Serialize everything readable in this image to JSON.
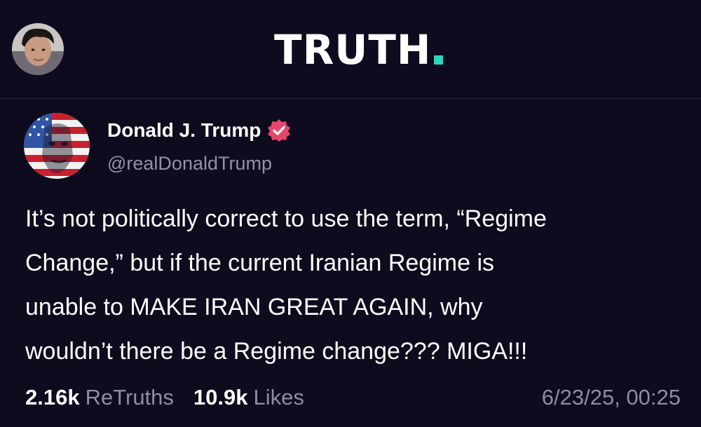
{
  "header": {
    "logo_text": "TRUTH",
    "logo_dot_color": "#2fd5b6",
    "user_avatar_icon": "profile-photo"
  },
  "post": {
    "author": {
      "name": "Donald J. Trump",
      "handle": "@realDonaldTrump",
      "verified": true,
      "verified_badge_color": "#e6476b",
      "avatar_icon": "american-flag-portrait"
    },
    "body_lines": [
      "It’s not politically correct to use the term, “Regime",
      "Change,” but if the current Iranian Regime is",
      "unable to MAKE IRAN GREAT AGAIN, why",
      "wouldn’t there be a Regime change??? MIGA!!!"
    ],
    "stats": {
      "retruths_count": "2.16k",
      "retruths_label": "ReTruths",
      "likes_count": "10.9k",
      "likes_label": "Likes"
    },
    "timestamp": "6/23/25, 00:25"
  },
  "colors": {
    "background": "#0d0b1d",
    "text": "#ffffff",
    "muted_text": "#8f8ca3",
    "divider": "#2a2840"
  }
}
